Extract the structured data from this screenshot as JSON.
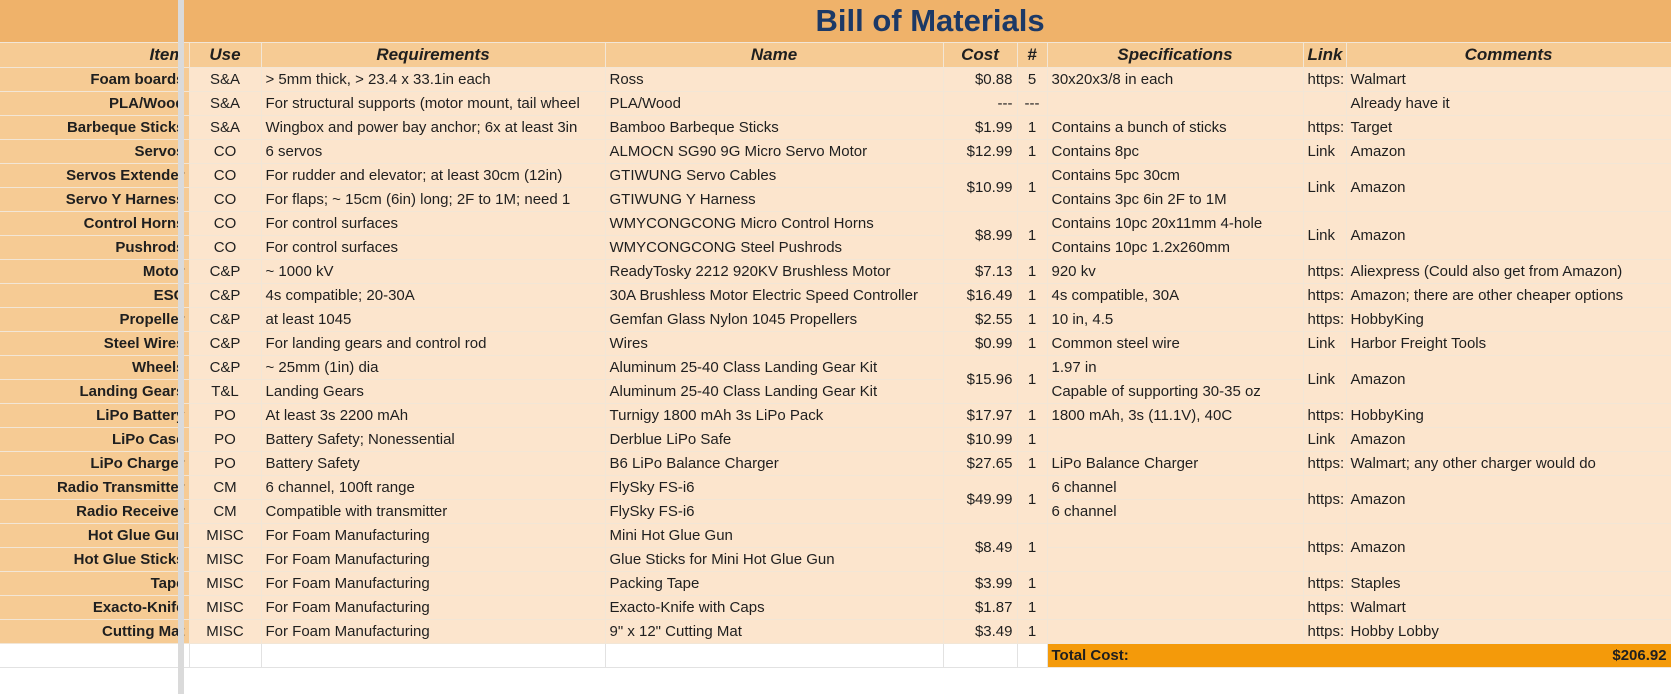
{
  "title": "Bill of Materials",
  "headers": {
    "item": "Item",
    "use": "Use",
    "requirements": "Requirements",
    "name": "Name",
    "cost": "Cost",
    "qty": "#",
    "specifications": "Specifications",
    "link": "Link",
    "comments": "Comments"
  },
  "rows": [
    {
      "item": "Foam boards",
      "use": "S&A",
      "req": "> 5mm thick, > 23.4 x 33.1in each",
      "name": "Ross",
      "cost": "$0.88",
      "qty": "5",
      "spec": "30x20x3/8 in each",
      "link": "https:",
      "comment": "Walmart"
    },
    {
      "item": "PLA/Wood",
      "use": "S&A",
      "req": "For structural supports (motor mount, tail wheel",
      "name": "PLA/Wood",
      "cost": "---",
      "qty": "---",
      "spec": "",
      "link": "",
      "comment": "Already have it"
    },
    {
      "item": "Barbeque Sticks",
      "use": "S&A",
      "req": "Wingbox and power bay anchor; 6x at least 3in",
      "name": "Bamboo Barbeque Sticks",
      "cost": "$1.99",
      "qty": "1",
      "spec": "Contains a bunch of sticks",
      "link": "https:",
      "comment": "Target"
    },
    {
      "item": "Servos",
      "use": "CO",
      "req": "6 servos",
      "name": "ALMOCN SG90 9G Micro Servo Motor",
      "cost": "$12.99",
      "qty": "1",
      "spec": "Contains 8pc",
      "link": "Link",
      "comment": "Amazon"
    },
    {
      "item": "Servos Extender",
      "use": "CO",
      "req": "For rudder and elevator; at least 30cm (12in)",
      "name": "GTIWUNG Servo Cables",
      "cost": "$10.99",
      "qty": "1",
      "spec": "Contains 5pc 30cm",
      "link": "Link",
      "comment": "Amazon"
    },
    {
      "item": "Servo Y Harness",
      "use": "CO",
      "req": "For flaps; ~ 15cm (6in) long; 2F to 1M; need 1",
      "name": "GTIWUNG Y Harness",
      "spec": "Contains 3pc 6in 2F to 1M"
    },
    {
      "item": "Control Horns",
      "use": "CO",
      "req": "For control surfaces",
      "name": "WMYCONGCONG Micro Control Horns",
      "cost": "$8.99",
      "qty": "1",
      "spec": "Contains 10pc 20x11mm 4-hole",
      "link": "Link",
      "comment": "Amazon"
    },
    {
      "item": "Pushrods",
      "use": "CO",
      "req": "For control surfaces",
      "name": "WMYCONGCONG Steel Pushrods",
      "spec": "Contains 10pc 1.2x260mm"
    },
    {
      "item": "Motor",
      "use": "C&P",
      "req": "~ 1000 kV",
      "name": "ReadyTosky 2212 920KV Brushless Motor",
      "cost": "$7.13",
      "qty": "1",
      "spec": "920 kv",
      "link": "https:",
      "comment": "Aliexpress (Could also get from Amazon)"
    },
    {
      "item": "ESC",
      "use": "C&P",
      "req": "4s compatible; 20-30A",
      "name": "30A Brushless Motor Electric Speed Controller",
      "cost": "$16.49",
      "qty": "1",
      "spec": "4s compatible, 30A",
      "link": "https:",
      "comment": "Amazon; there are other cheaper options"
    },
    {
      "item": "Propeller",
      "use": "C&P",
      "req": "at least 1045",
      "name": "Gemfan Glass Nylon 1045 Propellers",
      "cost": "$2.55",
      "qty": "1",
      "spec": "10 in, 4.5",
      "link": "https:",
      "comment": "HobbyKing"
    },
    {
      "item": "Steel Wires",
      "use": "C&P",
      "req": "For landing gears and control rod",
      "name": "Wires",
      "cost": "$0.99",
      "qty": "1",
      "spec": "Common steel wire",
      "link": "Link",
      "comment": "Harbor Freight Tools"
    },
    {
      "item": "Wheels",
      "use": "C&P",
      "req": "~ 25mm (1in) dia",
      "name": "Aluminum 25-40 Class Landing Gear Kit",
      "cost": "$15.96",
      "qty": "1",
      "spec": "1.97 in",
      "link": "Link",
      "comment": "Amazon"
    },
    {
      "item": "Landing Gears",
      "use": "T&L",
      "req": "Landing Gears",
      "name": "Aluminum 25-40 Class Landing Gear Kit",
      "spec": "Capable of supporting 30-35 oz"
    },
    {
      "item": "LiPo Battery",
      "use": "PO",
      "req": "At least 3s 2200 mAh",
      "name": "Turnigy 1800 mAh 3s LiPo Pack",
      "cost": "$17.97",
      "qty": "1",
      "spec": "1800 mAh, 3s (11.1V), 40C",
      "link": "https:",
      "comment": "HobbyKing"
    },
    {
      "item": "LiPo Case",
      "use": "PO",
      "req": "Battery Safety; Nonessential",
      "name": "Derblue LiPo Safe",
      "cost": "$10.99",
      "qty": "1",
      "spec": "",
      "link": "Link",
      "comment": "Amazon"
    },
    {
      "item": "LiPo Charger",
      "use": "PO",
      "req": "Battery Safety",
      "name": "B6 LiPo Balance Charger",
      "cost": "$27.65",
      "qty": "1",
      "spec": "LiPo Balance Charger",
      "link": "https:",
      "comment": "Walmart; any other charger would do"
    },
    {
      "item": "Radio Transmitter",
      "use": "CM",
      "req": "6 channel, 100ft range",
      "name": "FlySky FS-i6",
      "cost": "$49.99",
      "qty": "1",
      "spec": "6 channel",
      "link": "https:",
      "comment": "Amazon"
    },
    {
      "item": "Radio Receiver",
      "use": "CM",
      "req": "Compatible with transmitter",
      "name": "FlySky FS-i6",
      "spec": "6 channel"
    },
    {
      "item": "Hot Glue Gun",
      "use": "MISC",
      "req": "For Foam Manufacturing",
      "name": "Mini Hot Glue Gun",
      "cost": "$8.49",
      "qty": "1",
      "spec": "",
      "link": "https:",
      "comment": "Amazon"
    },
    {
      "item": "Hot Glue Sticks",
      "use": "MISC",
      "req": "For Foam Manufacturing",
      "name": "Glue Sticks for Mini Hot Glue Gun",
      "spec": ""
    },
    {
      "item": "Tape",
      "use": "MISC",
      "req": "For Foam Manufacturing",
      "name": "Packing Tape",
      "cost": "$3.99",
      "qty": "1",
      "spec": "",
      "link": "https:",
      "comment": "Staples"
    },
    {
      "item": "Exacto-Knife",
      "use": "MISC",
      "req": "For Foam Manufacturing",
      "name": "Exacto-Knife with Caps",
      "cost": "$1.87",
      "qty": "1",
      "spec": "",
      "link": "https:",
      "comment": "Walmart"
    },
    {
      "item": "Cutting Mat",
      "use": "MISC",
      "req": "For Foam Manufacturing",
      "name": "9\" x 12\" Cutting Mat",
      "cost": "$3.49",
      "qty": "1",
      "spec": "",
      "link": "https:",
      "comment": "Hobby Lobby"
    }
  ],
  "total": {
    "label": "Total Cost:",
    "value": "$206.92"
  }
}
